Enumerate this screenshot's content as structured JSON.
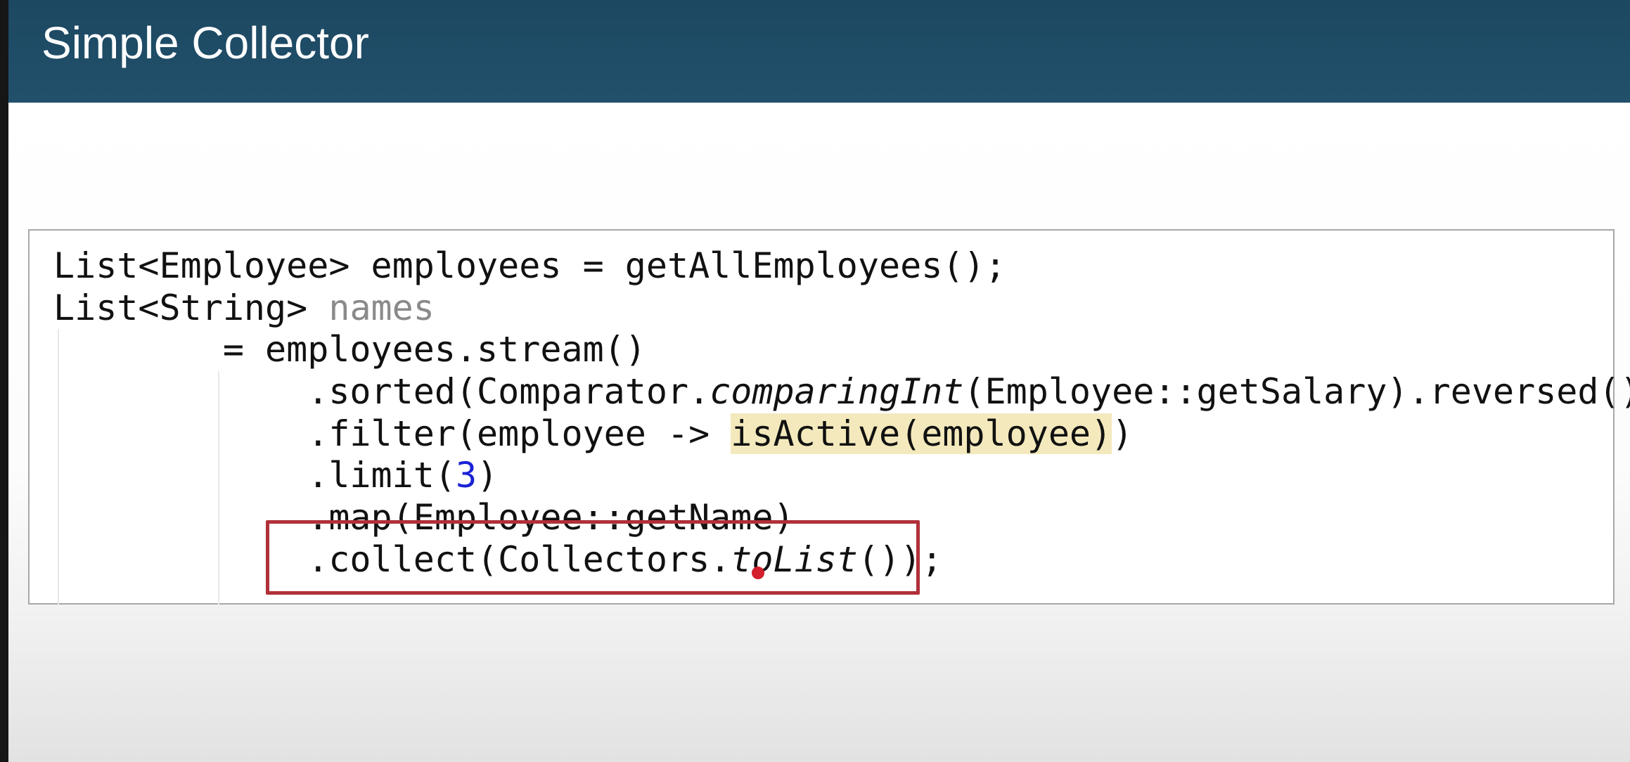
{
  "slide": {
    "title": "Simple Collector"
  },
  "code": {
    "line1": "List<Employee> employees = getAllEmployees();",
    "line2_type": "List<String> ",
    "line2_var": "names",
    "line3": "        = employees.stream()",
    "line4_a": "            .sorted(Comparator.",
    "line4_method": "comparingInt",
    "line4_b": "(Employee::getSalary).reversed())",
    "line5_a": "            .filter(employee -> ",
    "line5_highlight": "isActive(employee)",
    "line5_b": ")",
    "line6_a": "            .limit(",
    "line6_num": "3",
    "line6_b": ")",
    "line7": "            .map(Employee::getName)",
    "line8_a": "            .collect(Collectors.",
    "line8_method": "toList",
    "line8_b": "());"
  },
  "colors": {
    "header": "#1f4c66",
    "annotation_box": "#b0303a",
    "pointer": "#d41f2c",
    "number_literal": "#1b22d6",
    "highlight": "#f3e9bc"
  }
}
